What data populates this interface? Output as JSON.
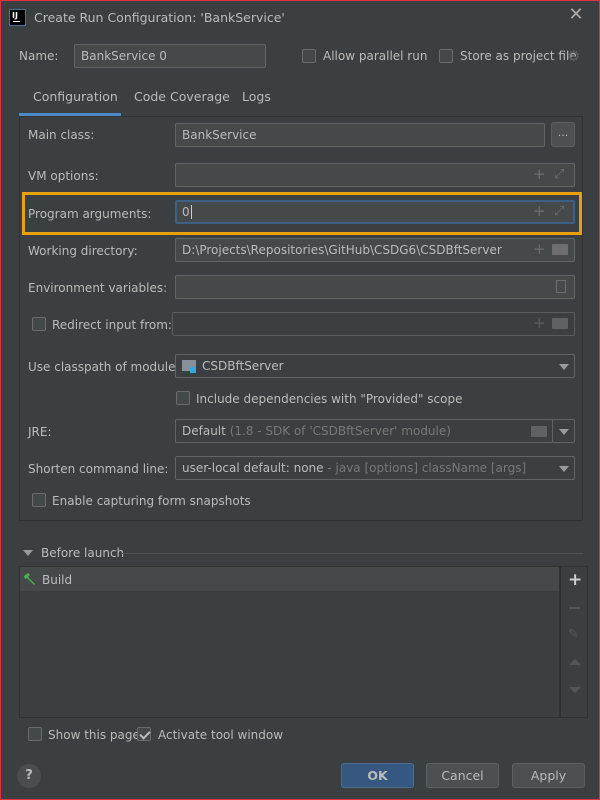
{
  "window": {
    "title": "Create Run Configuration: 'BankService'",
    "app_icon": "intellij-idea-icon",
    "close_icon": "close-icon"
  },
  "header": {
    "name_label": "Name:",
    "name_value": "BankService 0",
    "allow_parallel_run": {
      "label": "Allow parallel run",
      "checked": false
    },
    "store_as_project_file": {
      "label": "Store as project file",
      "checked": false
    },
    "settings_icon": "gear-icon"
  },
  "tabs": [
    {
      "label": "Configuration",
      "active": true
    },
    {
      "label": "Code Coverage",
      "active": false
    },
    {
      "label": "Logs",
      "active": false
    }
  ],
  "form": {
    "main_class": {
      "label": "Main class:",
      "value": "BankService",
      "browse_label": "..."
    },
    "vm_options": {
      "label": "VM options:",
      "value": ""
    },
    "program_arguments": {
      "label": "Program arguments:",
      "value": "0"
    },
    "working_directory": {
      "label": "Working directory:",
      "value": "D:\\Projects\\Repositories\\GitHub\\CSDG6\\CSDBftServer"
    },
    "environment_variables": {
      "label": "Environment variables:",
      "value": ""
    },
    "redirect_input": {
      "label": "Redirect input from:",
      "checked": false,
      "value": ""
    },
    "classpath_module": {
      "label": "Use classpath of module:",
      "value": "CSDBftServer"
    },
    "include_provided": {
      "label": "Include dependencies with \"Provided\" scope",
      "checked": false
    },
    "jre": {
      "label": "JRE:",
      "value_main": "Default",
      "value_hint": "(1.8 - SDK of 'CSDBftServer' module)"
    },
    "shorten_command_line": {
      "label": "Shorten command line:",
      "value_main": "user-local default: none",
      "value_hint": "- java [options] className [args]"
    },
    "enable_snapshots": {
      "label": "Enable capturing form snapshots",
      "checked": false
    }
  },
  "before_launch": {
    "title": "Before launch",
    "items": [
      {
        "label": "Build",
        "icon": "hammer-icon"
      }
    ],
    "toolbar": [
      "add-icon",
      "remove-icon",
      "edit-icon",
      "move-up-icon",
      "move-down-icon"
    ]
  },
  "footer": {
    "show_this_page": {
      "label": "Show this page",
      "checked": false
    },
    "activate_tool_window": {
      "label": "Activate tool window",
      "checked": true
    },
    "help_label": "?",
    "ok_label": "OK",
    "cancel_label": "Cancel",
    "apply_label": "Apply"
  },
  "colors": {
    "background": "#3c3f41",
    "accent": "#4a88c7",
    "highlight": "#e8a10c",
    "primary_button": "#365880",
    "window_border": "#e3323b",
    "build_icon": "#4caf50"
  }
}
